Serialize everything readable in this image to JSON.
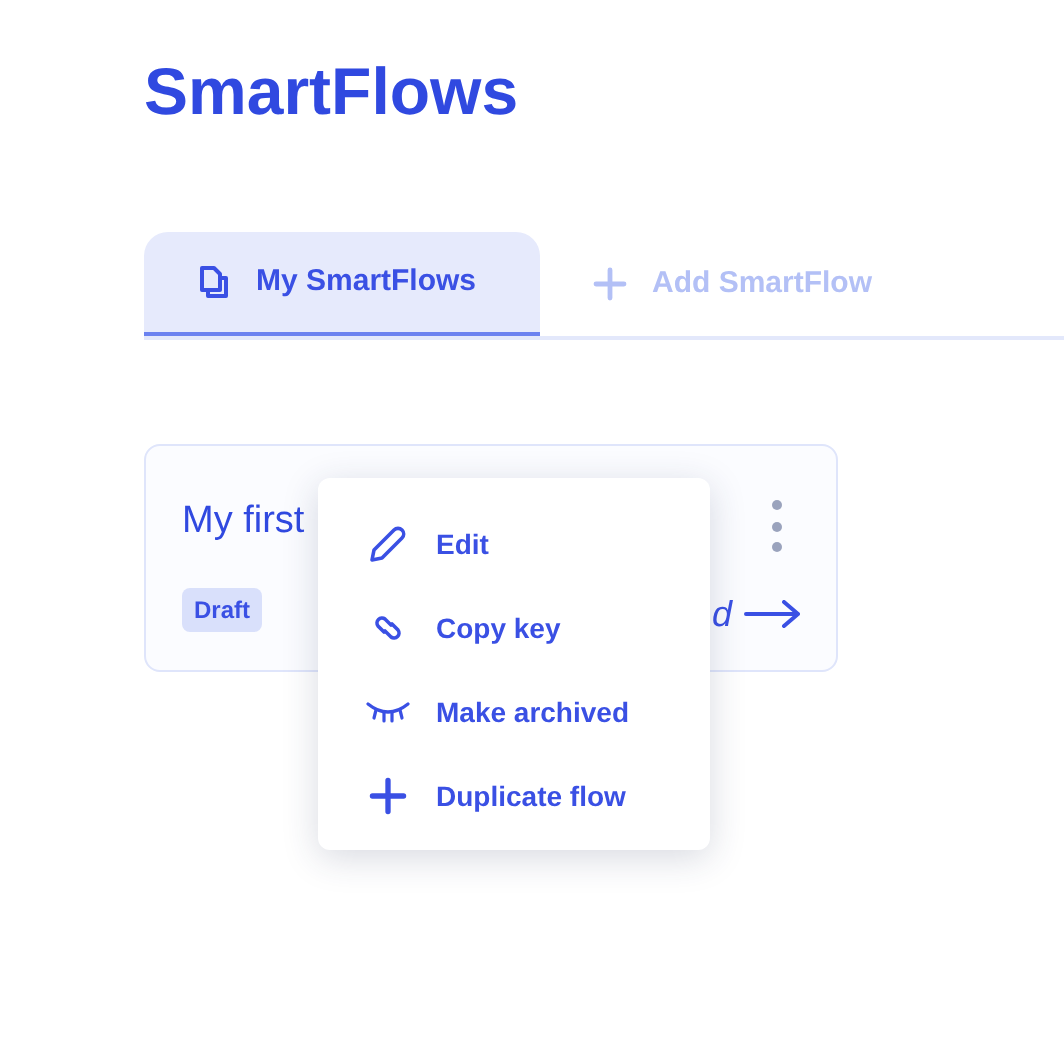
{
  "page_title": "SmartFlows",
  "tabs": [
    {
      "label": "My SmartFlows",
      "kind": "documents",
      "selected": true
    },
    {
      "label": "Add SmartFlow",
      "kind": "add",
      "selected": false
    }
  ],
  "cards": [
    {
      "title": "My first",
      "status": "Draft",
      "link_text": "d"
    }
  ],
  "context_menu": [
    {
      "label": "Edit",
      "kind": "edit"
    },
    {
      "label": "Copy key",
      "kind": "copy"
    },
    {
      "label": "Make archived",
      "kind": "archive"
    },
    {
      "label": "Duplicate flow",
      "kind": "duplicate"
    }
  ]
}
